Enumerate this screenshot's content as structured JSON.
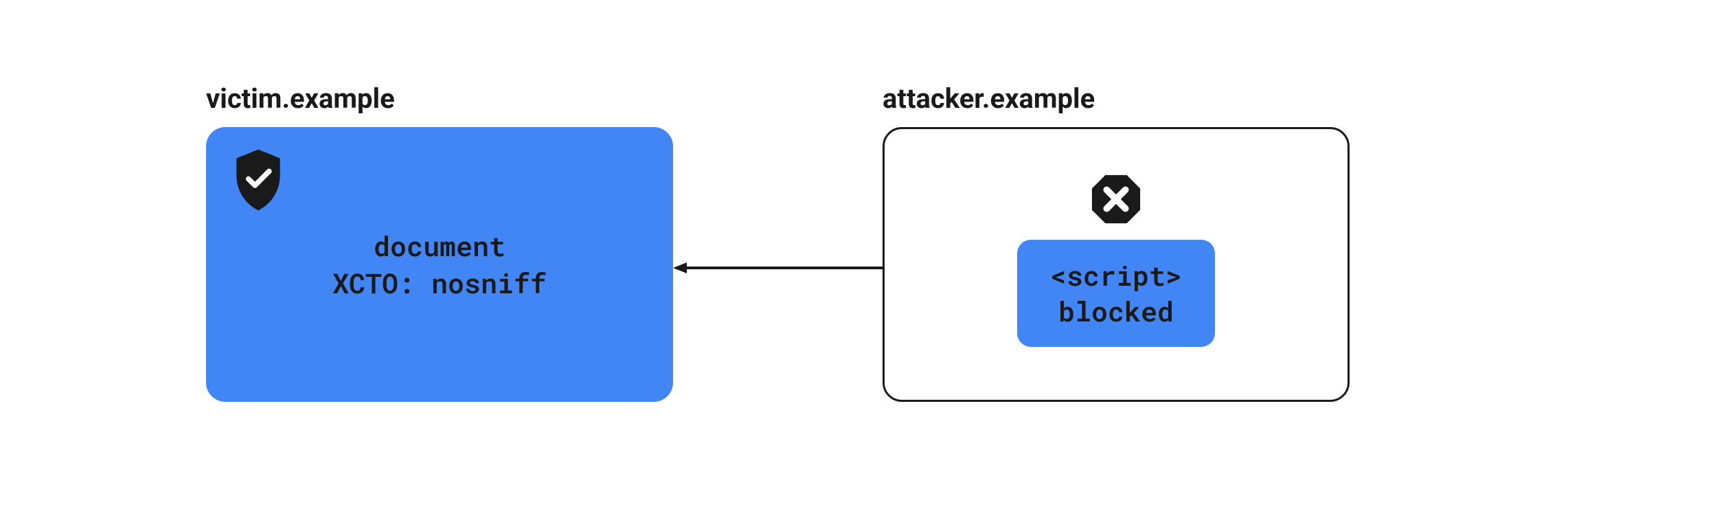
{
  "victim": {
    "label": "victim.example",
    "line1": "document",
    "line2": "XCTO: nosniff"
  },
  "attacker": {
    "label": "attacker.example",
    "script_line1": "<script>",
    "script_line2": "blocked"
  },
  "colors": {
    "blue": "#4285f4",
    "text": "#1a1a1a"
  }
}
